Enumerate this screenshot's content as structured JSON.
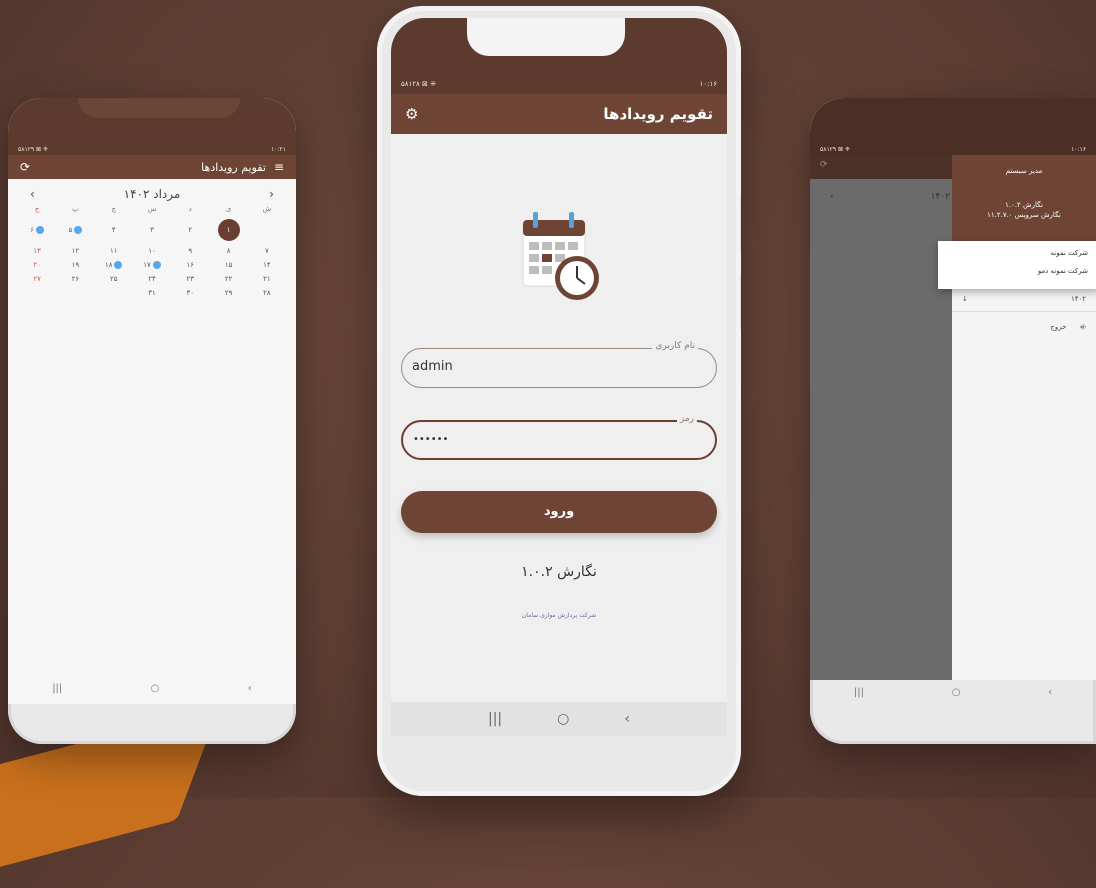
{
  "left_phone": {
    "status_left": "۵۸۱۲۹ ⊠ ⁜",
    "status_right": "۱۰:۲۱",
    "app_title": "تقویم رویدادها",
    "month_label": "مرداد  ۱۴۰۲",
    "weekdays": [
      "ش",
      "ی",
      "د",
      "س",
      "چ",
      "پ",
      "ج"
    ],
    "rows": [
      [
        "",
        "",
        "",
        "",
        "",
        "",
        ""
      ],
      [
        "۷",
        "۸",
        "۹",
        "۱۰",
        "۱۱",
        "۱۲",
        "۱۳"
      ],
      [
        "۱۴",
        "۱۵",
        "۱۶",
        "۱۷",
        "۱۸",
        "۱۹",
        "۲۰"
      ],
      [
        "۲۱",
        "۲۲",
        "۲۳",
        "۲۴",
        "۲۵",
        "۲۶",
        "۲۷"
      ],
      [
        "۲۸",
        "۲۹",
        "۳۰",
        "۳۱",
        "",
        "",
        ""
      ]
    ],
    "first_row": [
      "",
      "۱",
      "۲",
      "۳",
      "۴",
      "۵",
      "۶"
    ],
    "selected_day": "۱",
    "nav": [
      "|||",
      "○",
      "‹"
    ]
  },
  "center_phone": {
    "status_left": "۵۸۱۲۸ ⊠ ⁜",
    "status_right": "۱۰:۱۶",
    "app_title": "تقویم رویدادها",
    "username_label": "نام کاربری",
    "username_value": "admin",
    "password_label": "رمز",
    "password_value": "••••••",
    "login_button": "ورود",
    "version": "نگارش ۱.۰.۲",
    "company": "شرکت پردازش موازی سامان",
    "nav": [
      "|||",
      "○",
      "‹"
    ]
  },
  "right_phone": {
    "status_left": "۵۸۱۲۹ ⊠ ⁜",
    "status_right": "۱۰:۱۶",
    "month_label": "۱۴۰۲",
    "drawer_title": "مدیر سیستم",
    "drawer_version": "نگارش ۱.۰.۲",
    "drawer_service_version": "نگارش سرویس ۱۱.۲.۷.۰",
    "companies": [
      "شرکت نمونه",
      "شرکت نمونه دمو"
    ],
    "year_row": "۱۴۰۲",
    "logout": "خروج",
    "nav": [
      "|||",
      "○",
      "‹"
    ]
  },
  "colors": {
    "brand": "#6e4535",
    "background": "#5e3e33",
    "event_dot": "#57a8e8",
    "friday": "#d0584a"
  }
}
